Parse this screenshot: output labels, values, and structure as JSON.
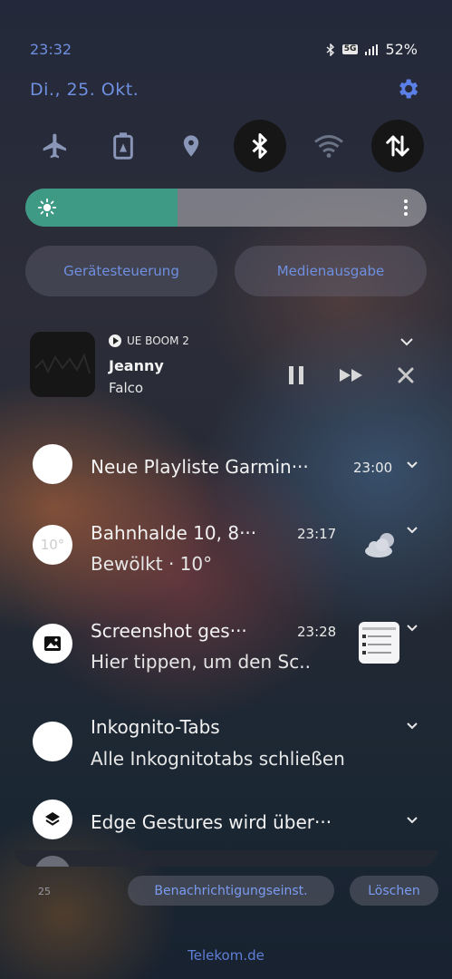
{
  "status": {
    "time": "23:32",
    "network": "5G",
    "battery": "52%"
  },
  "header": {
    "date": "Di., 25. Okt."
  },
  "quick_settings": [
    {
      "name": "airplane-mode",
      "active": false
    },
    {
      "name": "power-saving",
      "active": false
    },
    {
      "name": "location",
      "active": false
    },
    {
      "name": "bluetooth",
      "active": true
    },
    {
      "name": "wifi",
      "active": false
    },
    {
      "name": "mobile-data",
      "active": true
    }
  ],
  "brightness": {
    "level": 0.38
  },
  "buttons": {
    "device_control": "Gerätesteuerung",
    "media_output": "Medienausgabe"
  },
  "media": {
    "source": "UE BOOM 2",
    "title": "Jeanny",
    "artist": "Falco"
  },
  "notifications": [
    {
      "title": "Neue Playliste Garmin···",
      "time": "23:00",
      "subtitle": ""
    },
    {
      "title": "Bahnhalde 10, 8···",
      "time": "23:17",
      "subtitle": "Bewölkt · 10°",
      "avatar_text": "10°"
    },
    {
      "title": "Screenshot ges···",
      "time": "23:28",
      "subtitle": "Hier tippen, um den Sc.."
    },
    {
      "title": "Inkognito-Tabs",
      "time": "",
      "subtitle": "Alle Inkognitotabs schließen"
    },
    {
      "title": "Edge Gestures wird über···",
      "time": "",
      "subtitle": ""
    }
  ],
  "footer": {
    "count": "25",
    "settings_label": "Benachrichtigungseinst.",
    "clear_label": "Löschen",
    "carrier": "Telekom.de"
  },
  "colors": {
    "accent": "#6f8fe0",
    "brightness_fill": "#3e9a85",
    "toggle_on": "#161616"
  }
}
